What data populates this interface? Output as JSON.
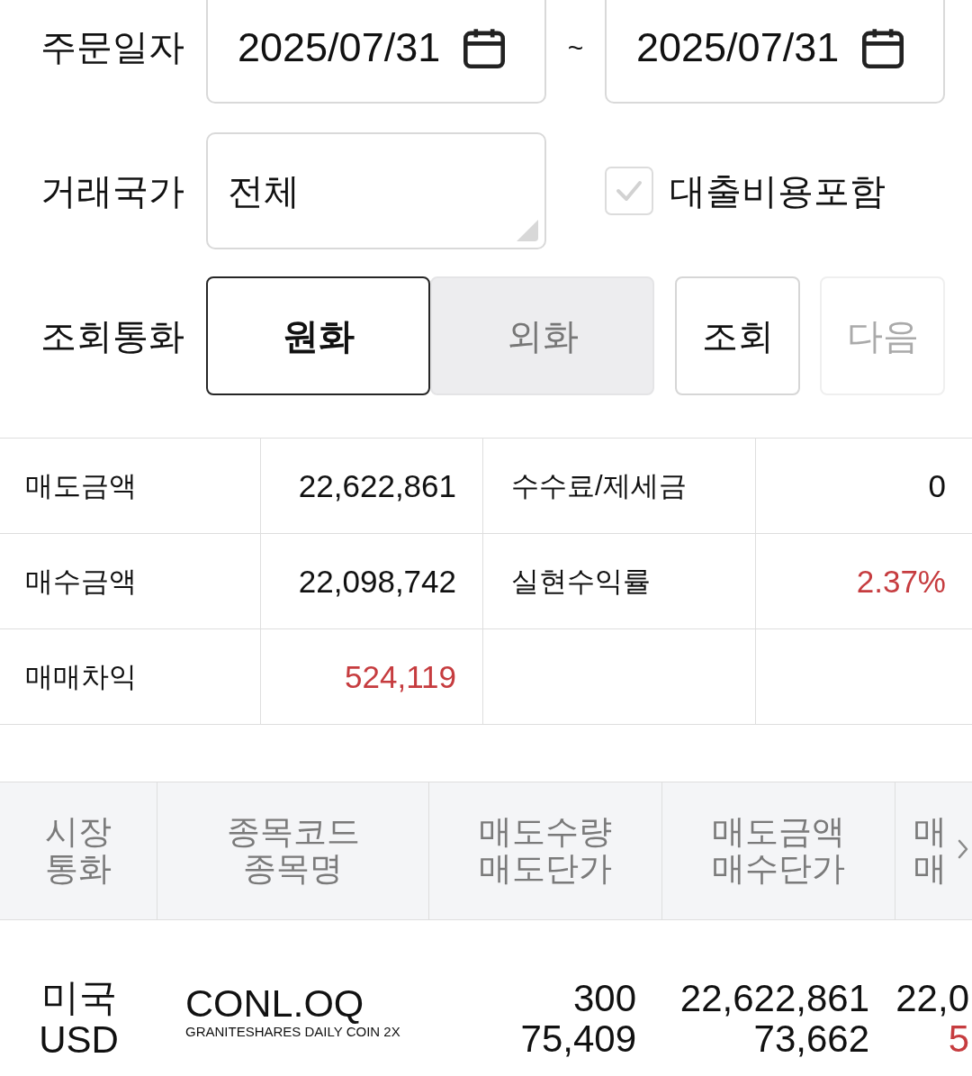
{
  "filters": {
    "order_date": {
      "label": "주문일자",
      "from": "2025/07/31",
      "separator": "~",
      "to": "2025/07/31"
    },
    "country": {
      "label": "거래국가",
      "value": "전체"
    },
    "include_loan_cost": {
      "label": "대출비용포함",
      "checked": false
    },
    "currency": {
      "label": "조회통화",
      "options": [
        {
          "label": "원화",
          "selected": true
        },
        {
          "label": "외화",
          "selected": false
        }
      ]
    },
    "buttons": [
      {
        "label": "조회",
        "disabled": false
      },
      {
        "label": "다음",
        "disabled": true
      }
    ]
  },
  "summary": {
    "rows": [
      {
        "cells": [
          {
            "label": "매도금액",
            "value": "22,622,861",
            "gain": false
          },
          {
            "label": "수수료/제세금",
            "value": "0",
            "gain": false
          }
        ]
      },
      {
        "cells": [
          {
            "label": "매수금액",
            "value": "22,098,742",
            "gain": false
          },
          {
            "label": "실현수익률",
            "value": "2.37%",
            "gain": true
          }
        ]
      },
      {
        "cells": [
          {
            "label": "매매차익",
            "value": "524,119",
            "gain": true
          }
        ]
      }
    ]
  },
  "orders": {
    "columns": [
      {
        "lines": [
          "시장",
          "통화"
        ]
      },
      {
        "lines": [
          "종목코드",
          "종목명"
        ]
      },
      {
        "lines": [
          "매도수량",
          "매도단가"
        ]
      },
      {
        "lines": [
          "매도금액",
          "매수단가"
        ]
      },
      {
        "lines": [
          "매",
          "매"
        ]
      }
    ],
    "rows": [
      {
        "cells": [
          {
            "kind": "text",
            "lines": [
              {
                "text": "미국",
                "gain": false
              },
              {
                "text": "USD",
                "gain": false
              }
            ]
          },
          {
            "kind": "instrument",
            "code": "CONL.OQ",
            "name": "GRANITESHARES DAILY COIN 2X"
          },
          {
            "kind": "number",
            "lines": [
              {
                "text": "300",
                "gain": false
              },
              {
                "text": "75,409",
                "gain": false
              }
            ]
          },
          {
            "kind": "number",
            "lines": [
              {
                "text": "22,622,861",
                "gain": false
              },
              {
                "text": "73,662",
                "gain": false
              }
            ]
          },
          {
            "kind": "number",
            "lines": [
              {
                "text": "22,0",
                "gain": false
              },
              {
                "text": "5",
                "gain": true
              }
            ]
          }
        ]
      }
    ]
  }
}
